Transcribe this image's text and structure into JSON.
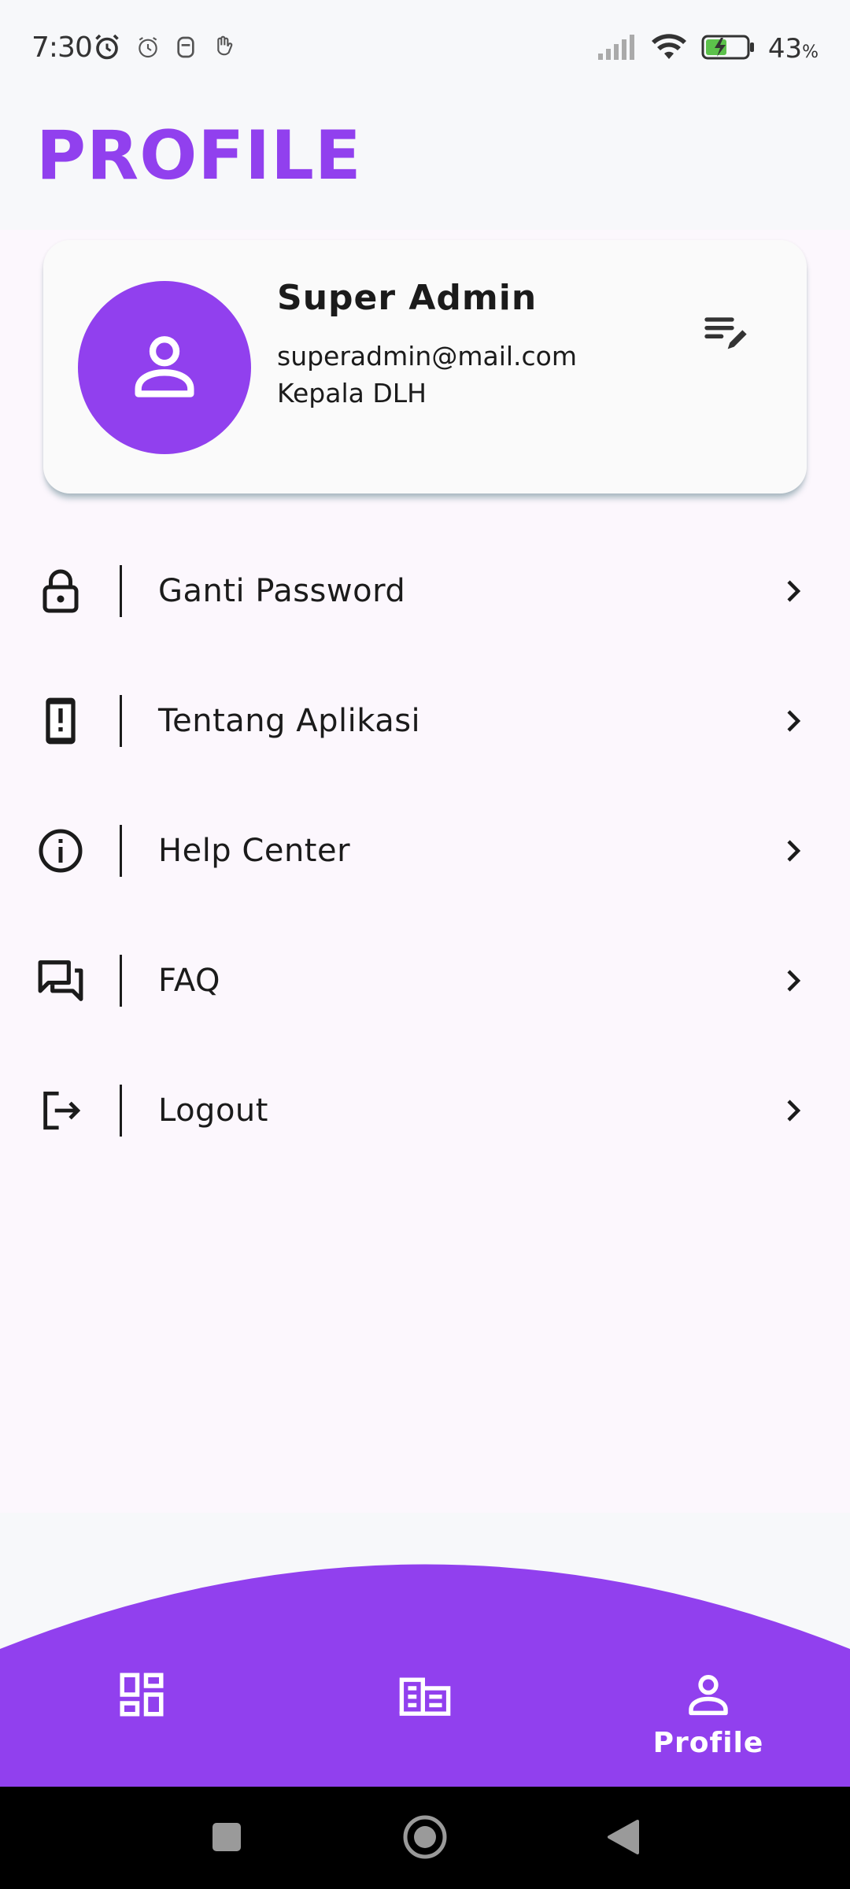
{
  "status_bar": {
    "time": "7:30",
    "battery_percent": "43",
    "battery_unit": "%",
    "icons_left": [
      "alarm-clock-icon",
      "alarm-icon",
      "shield-face-icon",
      "hand-icon"
    ],
    "icons_right": [
      "signal-icon",
      "wifi-icon",
      "battery-charging-icon"
    ]
  },
  "header": {
    "title": "PROFILE"
  },
  "profile": {
    "name": "Super Admin",
    "email": "superadmin@mail.com",
    "role": "Kepala DLH",
    "avatar_icon": "person-icon",
    "edit_icon": "edit-list-icon"
  },
  "menu": {
    "items": [
      {
        "label": "Ganti Password",
        "icon": "lock-icon"
      },
      {
        "label": "Tentang Aplikasi",
        "icon": "phone-alert-icon"
      },
      {
        "label": "Help Center",
        "icon": "info-icon"
      },
      {
        "label": "FAQ",
        "icon": "forum-icon"
      },
      {
        "label": "Logout",
        "icon": "logout-icon"
      }
    ]
  },
  "bottom_nav": {
    "items": [
      {
        "label": "",
        "icon": "dashboard-icon",
        "active": false
      },
      {
        "label": "",
        "icon": "building-list-icon",
        "active": false
      },
      {
        "label": "Profile",
        "icon": "person-icon",
        "active": true
      }
    ]
  },
  "colors": {
    "accent": "#9140EE",
    "page_background": "#F7F8FA",
    "content_background": "#FCF7FD",
    "card_background": "#FAFAFA",
    "text": "#1B1B1B"
  }
}
